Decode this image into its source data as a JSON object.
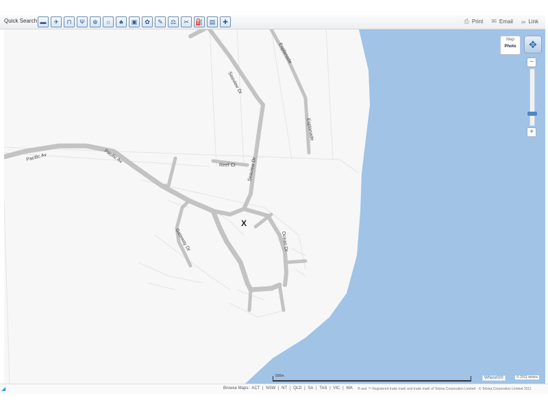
{
  "toolbar": {
    "quick_search_label": "Quick Search",
    "quick_search_icons": [
      {
        "name": "accommodation-icon",
        "glyph": "▬"
      },
      {
        "name": "airport-icon",
        "glyph": "✈"
      },
      {
        "name": "public-transport-icon",
        "glyph": "⊓"
      },
      {
        "name": "restaurant-icon",
        "glyph": "Ψ"
      },
      {
        "name": "attraction-icon",
        "glyph": "⊕"
      },
      {
        "name": "recreation-icon",
        "glyph": "☼"
      },
      {
        "name": "parks-icon",
        "glyph": "♣"
      },
      {
        "name": "car-services-icon",
        "glyph": "▣"
      },
      {
        "name": "services-icon",
        "glyph": "✿"
      },
      {
        "name": "trades-icon",
        "glyph": "✎"
      },
      {
        "name": "legal-icon",
        "glyph": "⚖"
      },
      {
        "name": "beauty-icon",
        "glyph": "✂"
      },
      {
        "name": "fuel-icon",
        "glyph": "⛽"
      },
      {
        "name": "shopping-icon",
        "glyph": "▤"
      },
      {
        "name": "medical-icon",
        "glyph": "✚"
      }
    ],
    "print_label": "Print",
    "email_label": "Email",
    "link_label": "Link"
  },
  "map": {
    "view_toggle": {
      "map_label": "Map",
      "photo_label": "Photo",
      "selected": "Photo"
    },
    "zoom_level_fraction": 0.18,
    "streets": {
      "seaview_dr_top": "Seaview Dr",
      "seaview_dr_mid": "Seaview Dr",
      "esplanade_top": "Esplanade",
      "esplanade_bottom": "Esplanade",
      "pacific_av_1": "Pacific Av",
      "pacific_av_2": "Pacific Av",
      "reef_ct": "Reef Ct",
      "gateway_dr": "Gateway Dr",
      "ocean_dr": "Ocean Dr"
    },
    "marker_label": "X",
    "scale_label": "500m",
    "brand_label": "WhereIS® ",
    "brand_copyright": "© 2011 telstra"
  },
  "footer": {
    "browse_label": "Browse Maps:",
    "states": [
      "ACT",
      "NSW",
      "NT",
      "QLD",
      "SA",
      "TAS",
      "VIC",
      "WA"
    ],
    "copyright": "® and ™ Registered trade mark and trade mark of Telstra Corporation Limited · © Telstra Corporation Limited 2011"
  },
  "colors": {
    "water": "#a0c3e6",
    "land": "#f7f7f7",
    "road": "#c3c3c3",
    "outline": "#e4e4e4"
  }
}
